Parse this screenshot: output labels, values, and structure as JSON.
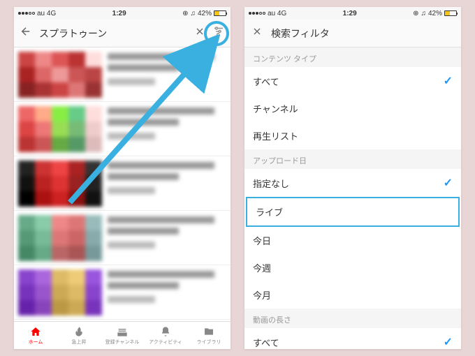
{
  "status": {
    "carrier": "au 4G",
    "time": "1:29",
    "battery": "42%"
  },
  "left": {
    "search_query": "スプラトゥーン",
    "tabs": {
      "home": "ホーム",
      "trending": "急上昇",
      "subs": "登録チャンネル",
      "activity": "アクティビティ",
      "library": "ライブラリ"
    }
  },
  "right": {
    "title": "検索フィルタ",
    "sections": {
      "content_type": {
        "label": "コンテンツ タイプ",
        "options": {
          "all": "すべて",
          "channel": "チャンネル",
          "playlist": "再生リスト"
        }
      },
      "upload_date": {
        "label": "アップロード日",
        "options": {
          "none": "指定なし",
          "live": "ライブ",
          "today": "今日",
          "week": "今週",
          "month": "今月"
        }
      },
      "duration": {
        "label": "動画の長さ",
        "options": {
          "all": "すべて"
        }
      }
    }
  }
}
